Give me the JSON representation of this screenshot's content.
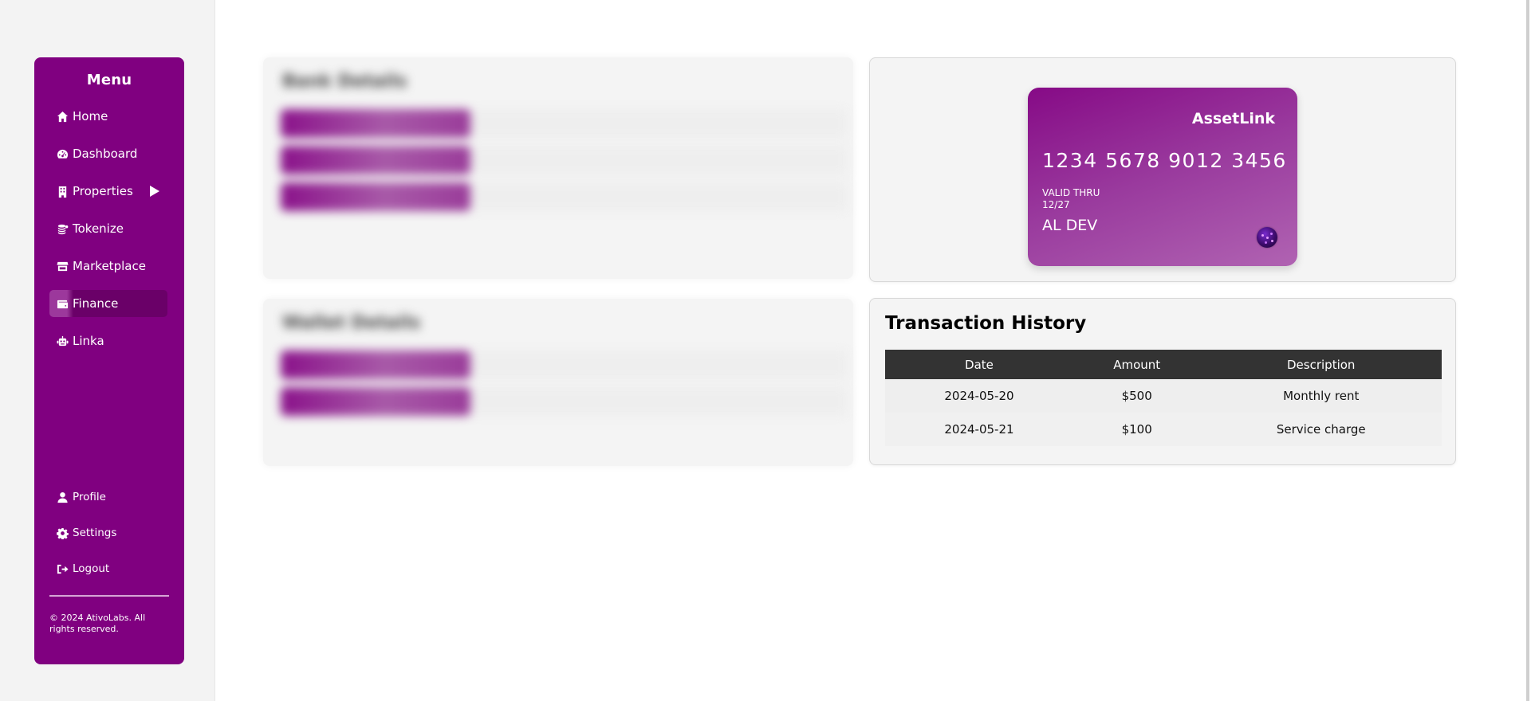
{
  "sidebar": {
    "title": "Menu",
    "items": [
      {
        "label": "Home",
        "icon": "home-icon"
      },
      {
        "label": "Dashboard",
        "icon": "gauge-icon"
      },
      {
        "label": "Properties",
        "icon": "building-icon",
        "has_submenu": true
      },
      {
        "label": "Tokenize",
        "icon": "coins-icon"
      },
      {
        "label": "Marketplace",
        "icon": "store-icon"
      },
      {
        "label": "Finance",
        "icon": "wallet-icon",
        "active": true
      },
      {
        "label": "Linka",
        "icon": "robot-icon"
      }
    ],
    "bottom_items": [
      {
        "label": "Profile",
        "icon": "user-icon"
      },
      {
        "label": "Settings",
        "icon": "gear-icon"
      },
      {
        "label": "Logout",
        "icon": "logout-icon"
      }
    ],
    "copyright": "© 2024 AtivoLabs. All rights reserved."
  },
  "blurred_panels": {
    "bank": {
      "title": "Bank Details",
      "rows": [
        {
          "label": "",
          "value": ""
        },
        {
          "label": "",
          "value": ""
        },
        {
          "label": "",
          "value": ""
        }
      ]
    },
    "wallet": {
      "title": "Wallet Details",
      "rows": [
        {
          "label": "",
          "value": ""
        },
        {
          "label": "",
          "value": ""
        }
      ]
    }
  },
  "card": {
    "brand": "AssetLink",
    "number": "1234 5678 9012 3456",
    "valid_label": "VALID THRU",
    "valid_date": "12/27",
    "holder": "AL DEV",
    "colors": {
      "start": "#860a86",
      "end": "#b063b2"
    }
  },
  "transactions": {
    "title": "Transaction History",
    "columns": [
      "Date",
      "Amount",
      "Description"
    ],
    "rows": [
      [
        "2024-05-20",
        "$500",
        "Monthly rent"
      ],
      [
        "2024-05-21",
        "$100",
        "Service charge"
      ]
    ]
  },
  "colors": {
    "brand": "#800080",
    "table_header": "#333333"
  }
}
